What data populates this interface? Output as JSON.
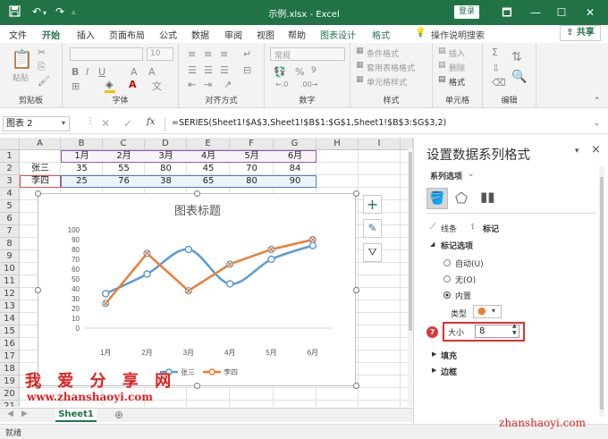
{
  "window": {
    "title": "示例.xlsx - Excel",
    "login_label": "登录",
    "controls": [
      "🗖",
      "—",
      "☐",
      "✕"
    ]
  },
  "quick_access": {
    "save_icon": "save-icon",
    "undo_icon": "undo-icon",
    "redo_icon": "redo-icon"
  },
  "menu": {
    "tabs": [
      "文件",
      "开始",
      "插入",
      "页面布局",
      "公式",
      "数据",
      "审阅",
      "视图",
      "帮助",
      "图表设计",
      "格式"
    ],
    "active_tab": "开始",
    "tell_me": "操作说明搜索",
    "share_label": "共享"
  },
  "ribbon": {
    "groups": [
      "剪贴板",
      "字体",
      "对齐方式",
      "数字",
      "样式",
      "单元格",
      "编辑"
    ],
    "paste_label": "粘贴",
    "number_format": "常规",
    "font_size": "10",
    "styles_items": [
      "条件格式",
      "套用表格格式",
      "单元格样式"
    ],
    "cells_items": [
      "插入",
      "删除",
      "格式"
    ]
  },
  "formula_bar": {
    "name_box": "图表 2",
    "fx_label": "fx",
    "formula": "=SERIES(Sheet1!$A$3,Sheet1!$B$1:$G$1,Sheet1!$B$3:$G$3,2)"
  },
  "grid": {
    "columns": [
      "A",
      "B",
      "C",
      "D",
      "E",
      "F",
      "G",
      "H",
      "I"
    ],
    "rows": [
      "1",
      "2",
      "3",
      "4",
      "5",
      "6",
      "7",
      "8",
      "9",
      "10",
      "11",
      "12",
      "13",
      "14",
      "15",
      "16",
      "17",
      "18",
      "19",
      "20",
      "21"
    ],
    "cells": {
      "header": [
        "1月",
        "2月",
        "3月",
        "4月",
        "5月",
        "6月"
      ],
      "row2_name": "张三",
      "row2": [
        "35",
        "55",
        "80",
        "45",
        "70",
        "84"
      ],
      "row3_name": "李四",
      "row3": [
        "25",
        "76",
        "38",
        "65",
        "80",
        "90"
      ]
    }
  },
  "chart_data": {
    "type": "line",
    "title": "图表标题",
    "categories": [
      "1月",
      "2月",
      "3月",
      "4月",
      "5月",
      "6月"
    ],
    "series": [
      {
        "name": "张三",
        "values": [
          35,
          55,
          80,
          45,
          70,
          84
        ],
        "color": "#5b9bd5"
      },
      {
        "name": "李四",
        "values": [
          25,
          76,
          38,
          65,
          80,
          90
        ],
        "color": "#ed7d31"
      }
    ],
    "ylim": [
      0,
      100
    ],
    "yticks": [
      "0",
      "10",
      "20",
      "30",
      "40",
      "50",
      "60",
      "70",
      "80",
      "90",
      "100"
    ],
    "legend_placement": "bottom",
    "grid": false
  },
  "chart_side_buttons": [
    "+",
    "✎",
    "⛛"
  ],
  "watermark": {
    "cn": "我 爱 分 享 网",
    "url": "www.zhanshaoyi.com",
    "corner": "zhanshaoyi.com"
  },
  "sheet_bar": {
    "sheet_name": "Sheet1",
    "add_label": "⊕"
  },
  "status_bar": {
    "status": "就绪"
  },
  "panel": {
    "title": "设置数据系列格式",
    "series_options": "系列选项",
    "subtabs": [
      "线条",
      "标记"
    ],
    "marker_options_header": "标记选项",
    "radio_options": [
      "自动(U)",
      "无(O)",
      "内置"
    ],
    "selected_radio": "内置",
    "type_label": "类型",
    "size_label": "大小",
    "size_value": "8",
    "sections": [
      "填充",
      "边框"
    ],
    "step_badge": "7",
    "close_label": "×"
  }
}
